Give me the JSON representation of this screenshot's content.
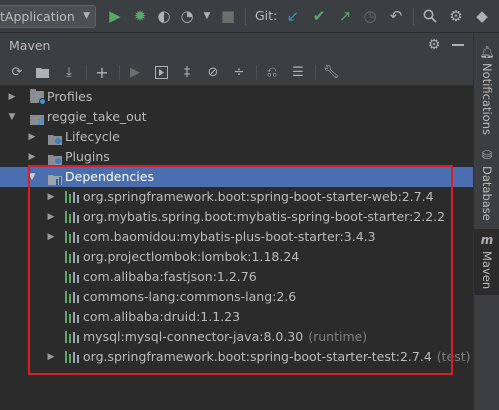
{
  "topbar": {
    "run_config": "tApplication",
    "git_label": "Git:"
  },
  "panel": {
    "title": "Maven"
  },
  "tree": {
    "project": "reggie_take_out",
    "profiles": "Profiles",
    "lifecycle": "Lifecycle",
    "plugins": "Plugins",
    "dependencies": "Dependencies",
    "deps": [
      {
        "name": "org.springframework.boot:spring-boot-starter-web:2.7.4",
        "scope": "",
        "expandable": true
      },
      {
        "name": "org.mybatis.spring.boot:mybatis-spring-boot-starter:2.2.2",
        "scope": "",
        "expandable": true
      },
      {
        "name": "com.baomidou:mybatis-plus-boot-starter:3.4.3",
        "scope": "",
        "expandable": true
      },
      {
        "name": "org.projectlombok:lombok:1.18.24",
        "scope": "",
        "expandable": false
      },
      {
        "name": "com.alibaba:fastjson:1.2.76",
        "scope": "",
        "expandable": false
      },
      {
        "name": "commons-lang:commons-lang:2.6",
        "scope": "",
        "expandable": false
      },
      {
        "name": "com.alibaba:druid:1.1.23",
        "scope": "",
        "expandable": false
      },
      {
        "name": "mysql:mysql-connector-java:8.0.30",
        "scope": "(runtime)",
        "expandable": false
      },
      {
        "name": "org.springframework.boot:spring-boot-starter-test:2.7.4",
        "scope": "(test)",
        "expandable": true
      }
    ]
  },
  "side_tabs": {
    "notifications": "Notifications",
    "database": "Database",
    "maven": "Maven"
  },
  "colors": {
    "selection": "#4b6eaf",
    "highlight_box": "#e01b24",
    "run_green": "#59a869",
    "vcs_blue": "#3592c4"
  }
}
